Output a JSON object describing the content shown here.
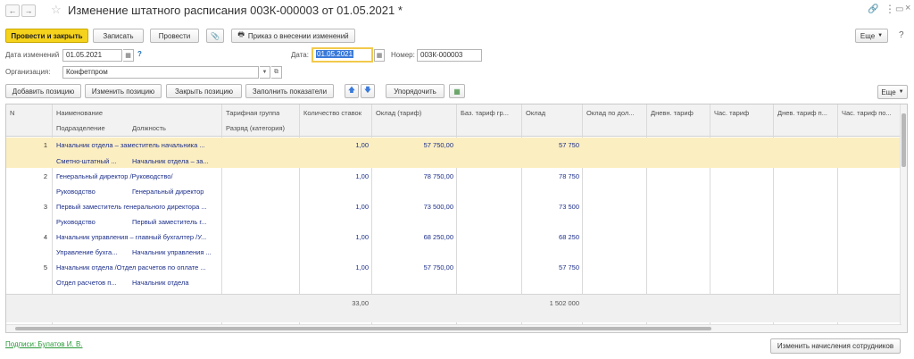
{
  "window": {
    "title": "Изменение штатного расписания 003К-000003 от 01.05.2021 *"
  },
  "toolbar": {
    "post_close": "Провести и закрыть",
    "save": "Записать",
    "post": "Провести",
    "order": "Приказ о внесении изменений",
    "more": "Еще"
  },
  "form": {
    "date_change_label": "Дата изменений",
    "date_change_value": "01.05.2021",
    "help": "?",
    "date_label": "Дата:",
    "date_value": "01.05.2021",
    "number_label": "Номер:",
    "number_value": "003К-000003",
    "org_label": "Организация:",
    "org_value": "Конфетпром"
  },
  "table_toolbar": {
    "add": "Добавить позицию",
    "edit": "Изменить позицию",
    "close": "Закрыть позицию",
    "fill": "Заполнить показатели",
    "sort": "Упорядочить",
    "more": "Еще"
  },
  "table": {
    "headers": {
      "n": "N",
      "name": "Наименование",
      "division": "Подразделение",
      "position": "Должность",
      "tariff_group": "Тарифная группа",
      "grade": "Разряд (категория)",
      "rate_count": "Количество ставок",
      "salary_tariff": "Оклад (тариф)",
      "base_tariff": "Баз. тариф гр...",
      "salary": "Оклад",
      "salary_by": "Оклад по дол...",
      "daily_tariff": "Дневн. тариф",
      "hour_tariff": "Час. тариф",
      "daily_tariff_by": "Днев. тариф п...",
      "hour_tariff_by": "Час. тариф по..."
    },
    "rows": [
      {
        "n": "1",
        "name": "Начальник отдела – заместитель начальника ...",
        "division": "Сметно-штатный ...",
        "position": "Начальник отдела – за...",
        "rate": "1,00",
        "salary_tariff": "57 750,00",
        "salary": "57 750"
      },
      {
        "n": "2",
        "name": "Генеральный директор /Руководство/",
        "division": "Руководство",
        "position": "Генеральный директор",
        "rate": "1,00",
        "salary_tariff": "78 750,00",
        "salary": "78 750"
      },
      {
        "n": "3",
        "name": "Первый заместитель генерального директора ...",
        "division": "Руководство",
        "position": "Первый заместитель г...",
        "rate": "1,00",
        "salary_tariff": "73 500,00",
        "salary": "73 500"
      },
      {
        "n": "4",
        "name": "Начальник управления – главный бухгалтер /У...",
        "division": "Управление бухга...",
        "position": "Начальник управления ...",
        "rate": "1,00",
        "salary_tariff": "68 250,00",
        "salary": "68 250"
      },
      {
        "n": "5",
        "name": "Начальник отдела /Отдел расчетов по оплате ...",
        "division": "Отдел расчетов п...",
        "position": "Начальник отдела",
        "rate": "1,00",
        "salary_tariff": "57 750,00",
        "salary": "57 750"
      }
    ],
    "totals": {
      "rate": "33,00",
      "salary": "1 502 000"
    }
  },
  "bottom": {
    "signatures": "Подписи: Булатов И. В.",
    "change_accruals": "Изменить начисления сотрудников"
  },
  "colors": {
    "primary_button": "#f5d21c",
    "selected_row": "#fbeec1",
    "link": "#2b9a3a",
    "cell_text": "#1b2e8a"
  }
}
